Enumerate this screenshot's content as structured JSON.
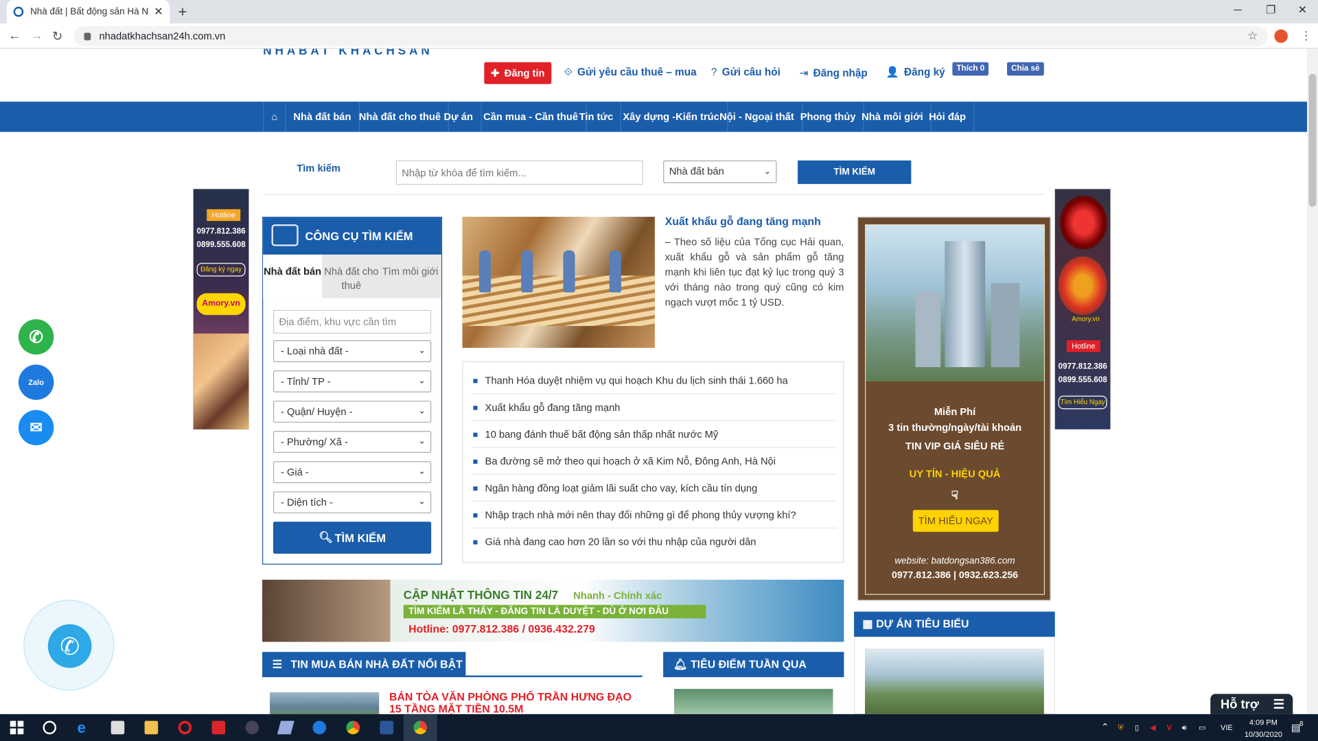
{
  "browser": {
    "tab_title": "Nhà đất | Bất động sản Hà Nội | N",
    "url": "nhadatkhachsan24h.com.vn",
    "tab_close": "✕",
    "new_tab": "+"
  },
  "header": {
    "logo_text": "NHABAT KHACHSAN",
    "post_button": "Đăng tin",
    "links": [
      "Gửi yêu cầu thuê – mua",
      "Gửi câu hỏi",
      "Đăng nhập",
      "Đăng ký"
    ],
    "fb_like": "Thích 0",
    "fb_share": "Chia sẻ"
  },
  "nav": {
    "home_icon": "⌂",
    "items": [
      "Nhà đất bán",
      "Nhà đất cho thuê",
      "Dự án",
      "Cần mua - Cần thuê",
      "Tin tức",
      "Xây dựng -Kiến trúc",
      "Nội - Ngoại thất",
      "Phong thủy",
      "Nhà môi giới",
      "Hỏi đáp"
    ]
  },
  "search": {
    "label": "Tìm kiếm",
    "placeholder": "Nhập từ khóa để tìm kiếm...",
    "category": "Nhà đất bán",
    "button": "TÌM KIẾM"
  },
  "left_ad": {
    "hotline_label": "Hotline",
    "phones": [
      "0977.812.386",
      "0899.555.608"
    ],
    "register": "Đăng ký ngay",
    "brand": "Amory.vn"
  },
  "right_ad": {
    "brand": "Amory.vn",
    "hotline_label": "Hotline",
    "phones": [
      "0977.812.386",
      "0899.555.608"
    ],
    "cta": "Tìm Hiểu Ngay"
  },
  "search_tool": {
    "title": "CÔNG CỤ TÌM KIẾM",
    "tabs": [
      "Nhà đất bán",
      "Nhà đất cho thuê",
      "Tìm môi giới"
    ],
    "location_placeholder": "Địa điểm, khu vực cần tìm",
    "selects": [
      "- Loại nhà đất -",
      "- Tỉnh/ TP -",
      "- Quận/ Huyện -",
      "- Phường/ Xã -",
      "- Giá -",
      "- Diện tích -"
    ],
    "button": "TÌM KIẾM"
  },
  "featured": {
    "title": "Xuất khẩu gỗ đang tăng mạnh",
    "summary": "– Theo số liệu của Tổng cục Hải quan, xuất khẩu gỗ và sản phẩm gỗ tăng mạnh khi liên tục đạt kỷ lục trong quý 3 với tháng nào trong quý cũng có kim ngạch vượt mốc 1 tỷ USD.",
    "news": [
      "Thanh Hóa duyệt nhiệm vụ qui hoạch Khu du lịch sinh thái 1.660 ha",
      "Xuất khẩu gỗ đang tăng mạnh",
      "10 bang đánh thuế bất động sản thấp nhất nước Mỹ",
      "Ba đường sẽ mở theo qui hoạch ở xã Kim Nỗ, Đông Anh, Hà Nội",
      "Ngân hàng đồng loạt giảm lãi suất cho vay, kích cầu tín dụng",
      "Nhập trạch nhà mới nên thay đổi những gì để phong thủy vượng khí?",
      "Giá nhà đang cao hơn 20 lần so với thu nhập của người dân"
    ]
  },
  "promo": {
    "line1": "Miễn Phí",
    "line2": "3 tin thường/ngày/tài khoản",
    "line3": "TIN VIP GIÁ SIÊU RẺ",
    "line4": "UY TÍN - HIỆU QUẢ",
    "button": "TÌM HIỂU NGAY",
    "website": "website: batdongsan386.com",
    "phones": "0977.812.386  |  0932.623.256"
  },
  "banner": {
    "title": "CẬP NHẬT THÔNG TIN 24/7",
    "sub": "Nhanh - Chính xác",
    "tagline": "TÌM KIẾM LÀ THẤY - ĐĂNG TIN LÀ DUYỆT - DÙ Ở NƠI ĐÂU",
    "hotline": "Hotline: 0977.812.386 / 0936.432.279"
  },
  "sections": {
    "hot_news": "TIN MUA BÁN NHÀ ĐẤT NỔI BẬT",
    "weekly": "TIÊU ĐIỂM TUẦN QUA",
    "projects": "DỰ ÁN TIÊU BIỂU",
    "hot_item": "BÁN TÒA VĂN PHÒNG PHỐ TRẦN HƯNG ĐẠO 15 TẦNG MẶT TIỀN 10.5M"
  },
  "support": {
    "label": "Hỗ trợ"
  },
  "taskbar": {
    "lang": "VIE",
    "time": "4:09 PM",
    "date": "10/30/2020",
    "notif_count": "8"
  }
}
